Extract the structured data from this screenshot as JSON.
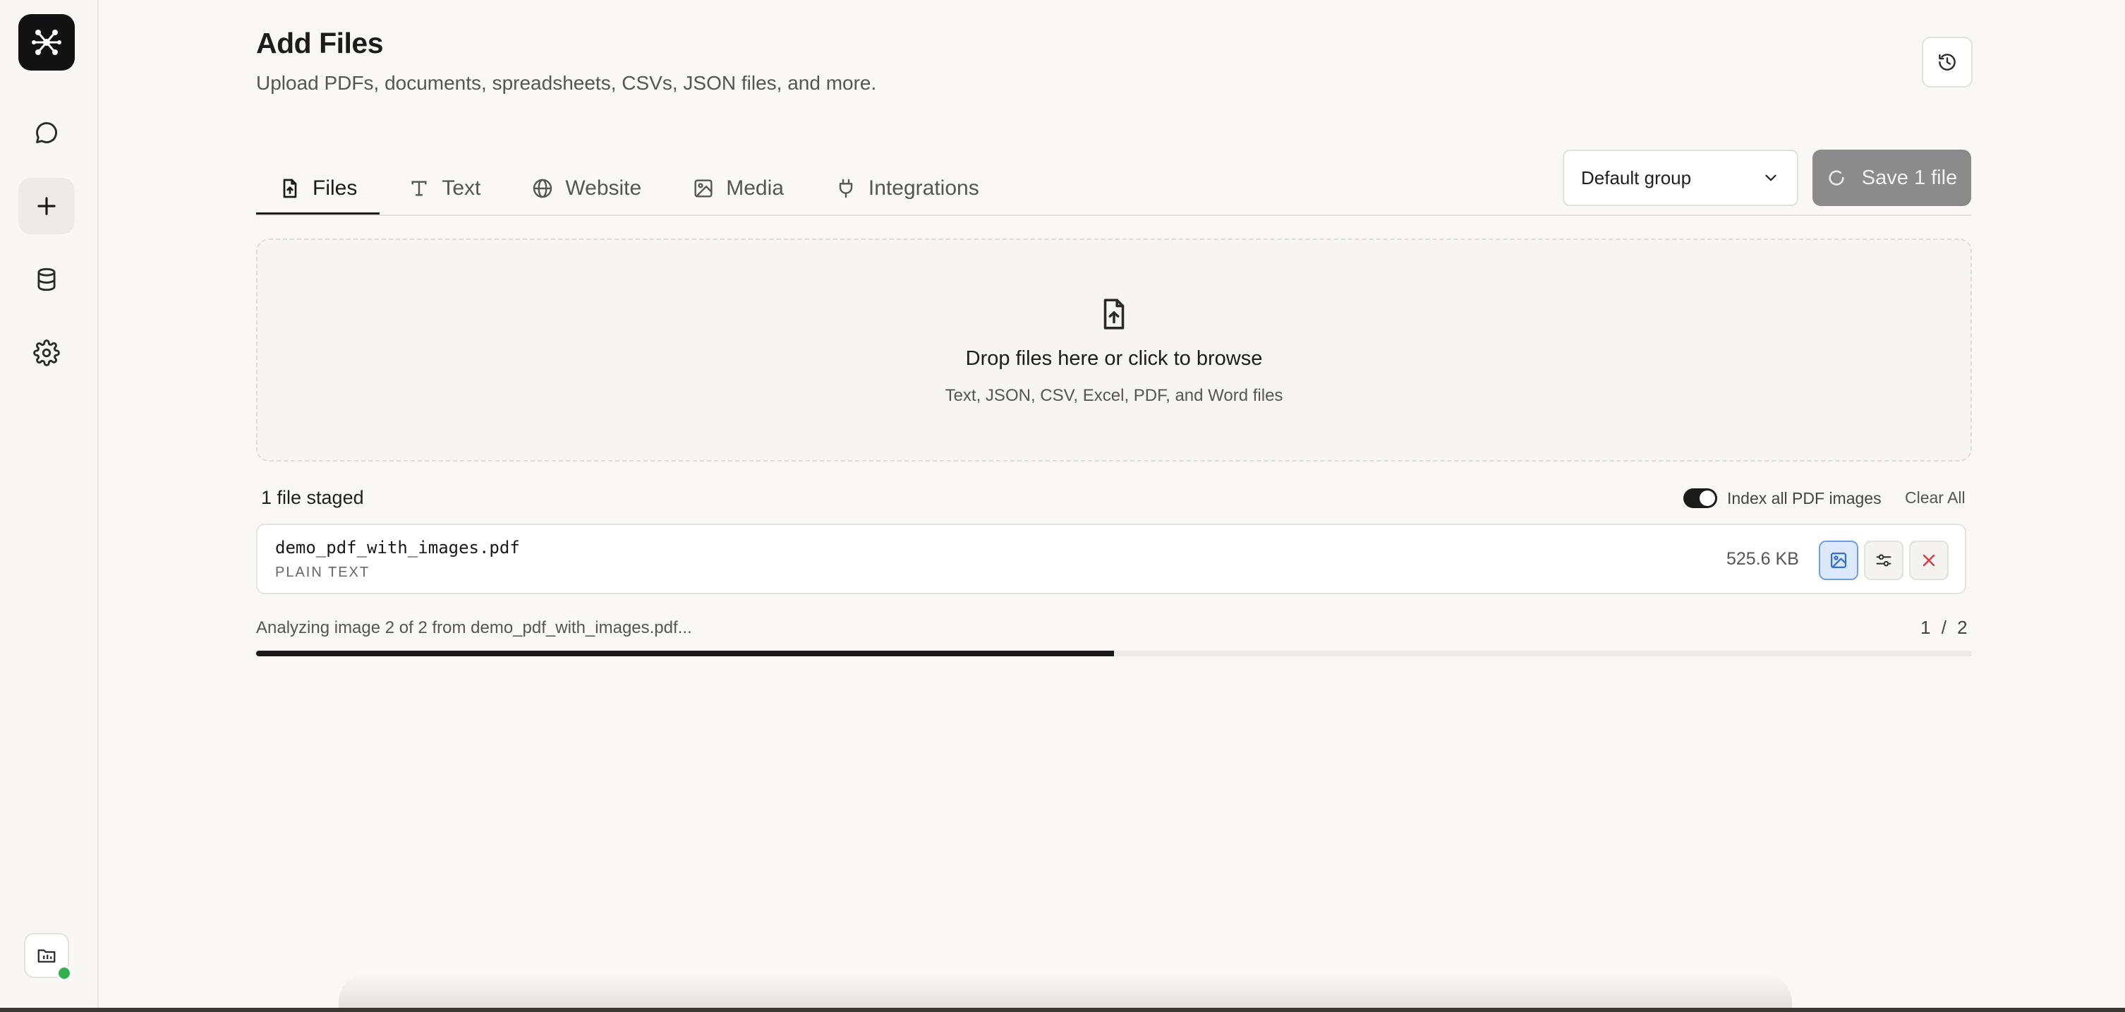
{
  "header": {
    "title": "Add Files",
    "subtitle": "Upload PDFs, documents, spreadsheets, CSVs, JSON files, and more."
  },
  "sidebar": {
    "items": [
      {
        "name": "chat",
        "icon": "chat-bubble-icon"
      },
      {
        "name": "add",
        "icon": "plus-icon",
        "active": true
      },
      {
        "name": "database",
        "icon": "database-icon"
      },
      {
        "name": "settings",
        "icon": "gear-icon"
      }
    ]
  },
  "tabs": [
    {
      "label": "Files",
      "icon": "file-upload-icon",
      "active": true
    },
    {
      "label": "Text",
      "icon": "text-type-icon"
    },
    {
      "label": "Website",
      "icon": "globe-icon"
    },
    {
      "label": "Media",
      "icon": "image-icon"
    },
    {
      "label": "Integrations",
      "icon": "plug-icon"
    }
  ],
  "group_select": {
    "value": "Default group"
  },
  "save_button": {
    "label": "Save 1 file"
  },
  "dropzone": {
    "title": "Drop files here or click to browse",
    "subtitle": "Text, JSON, CSV, Excel, PDF, and Word files"
  },
  "staged": {
    "count_label": "1 file staged",
    "toggle_label": "Index all PDF images",
    "toggle_on": true,
    "clear_label": "Clear All",
    "files": [
      {
        "name": "demo_pdf_with_images.pdf",
        "type": "PLAIN TEXT",
        "size": "525.6 KB"
      }
    ]
  },
  "progress": {
    "text": "Analyzing image 2 of 2 from demo_pdf_with_images.pdf...",
    "current": "1",
    "separator": "/",
    "total": "2",
    "fraction": 0.5
  },
  "colors": {
    "accent": "#1a1a1a",
    "save_button": "#8b8b8b",
    "status_online": "#2fb24c",
    "remove": "#d9363e",
    "image_button": "#2f6fdc"
  }
}
